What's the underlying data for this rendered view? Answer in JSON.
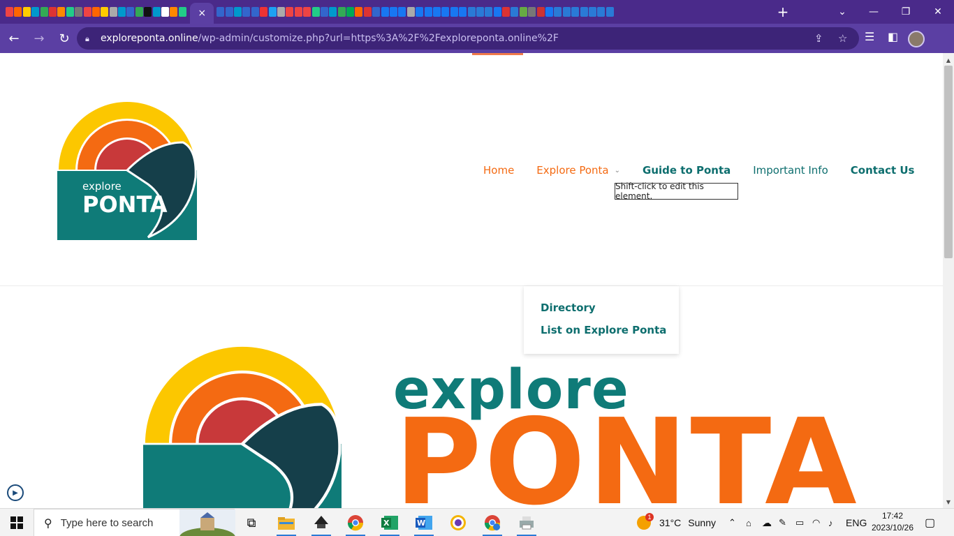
{
  "browser": {
    "active_tab_close": "×",
    "new_tab": "+",
    "url_host": "exploreponta.online",
    "url_path": "/wp-admin/customize.php?url=https%3A%2F%2Fexploreponta.online%2F",
    "tab_icon_colors": [
      "#e44",
      "#f60",
      "#fc0",
      "#09c",
      "#3a5",
      "#d33",
      "#f80",
      "#2c8",
      "#777",
      "#e44",
      "#f60",
      "#fc0",
      "#aaa",
      "#09c",
      "#36c",
      "#3a5",
      "#111",
      "#09c",
      "#fff",
      "#f80",
      "#2c8",
      "#36c",
      "#36c",
      "#09c",
      "#36c",
      "#36c",
      "#e33",
      "#1da1f2",
      "#aaa",
      "#e44",
      "#e44",
      "#e44",
      "#2c8",
      "#36c",
      "#09c",
      "#3a5",
      "#0a5",
      "#f60",
      "#d33",
      "#36c",
      "#1877f2",
      "#1877f2",
      "#1877f2",
      "#aaa",
      "#1877f2",
      "#1877f2",
      "#1877f2",
      "#1877f2",
      "#1877f2",
      "#1877f2",
      "#2a7ad6",
      "#2a7ad6",
      "#2a7ad6",
      "#1877f2",
      "#d33",
      "#2a7ad6",
      "#6a4",
      "#777",
      "#c33",
      "#1877f2",
      "#2a7ad6",
      "#2a7ad6",
      "#2a7ad6",
      "#2a7ad6",
      "#2a7ad6",
      "#2a7ad6",
      "#2a7ad6"
    ]
  },
  "site": {
    "nav": [
      {
        "label": "Home",
        "color": "#f46a12",
        "has_chevron": false
      },
      {
        "label": "Explore Ponta",
        "color": "#f46a12",
        "has_chevron": true
      },
      {
        "label": "Guide to Ponta",
        "color": "#0d6e6e",
        "has_chevron": false
      },
      {
        "label": "Important Info",
        "color": "#0d6e6e",
        "has_chevron": false
      },
      {
        "label": "Contact Us",
        "color": "#0d6e6e",
        "has_chevron": true
      }
    ],
    "tooltip": "Shift-click to edit this element.",
    "dropdown": [
      "Directory",
      "List on Explore Ponta"
    ],
    "logo_small_explore": "explore",
    "logo_small_ponta": "PONTA",
    "hero_explore": "explore",
    "hero_ponta": "PONTA",
    "colors": {
      "teal": "#0f7b78",
      "orange": "#f46a12",
      "yellow": "#fcc700",
      "red": "#c8393a",
      "dark_teal": "#153f4a"
    }
  },
  "taskbar": {
    "search_placeholder": "Type here to search",
    "weather_temp": "31°C",
    "weather_desc": "Sunny",
    "weather_badge": "1",
    "language": "ENG",
    "time": "17:42",
    "date": "2023/10/26"
  }
}
